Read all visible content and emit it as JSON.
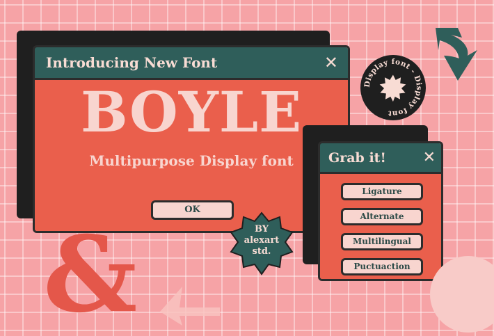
{
  "main_window": {
    "title": "Introducing New Font",
    "headline": "BOYLE",
    "subtitle": "Multipurpose Display font",
    "ok_label": "OK"
  },
  "side_window": {
    "title": "Grab it!",
    "buttons": [
      "Ligature",
      "Alternate",
      "Multilingual",
      "Puctuaction"
    ]
  },
  "badge": {
    "line1": "BY",
    "line2": "alexart",
    "line3": "std."
  },
  "stamp": {
    "text": "Display font - Display font"
  },
  "glyphs": {
    "ampersand": "&"
  },
  "colors": {
    "background": "#f6a3a6",
    "titlebar": "#2f5e5a",
    "body": "#ea5f4c",
    "cream": "#f8dcd4",
    "dark": "#1f1f1f"
  }
}
